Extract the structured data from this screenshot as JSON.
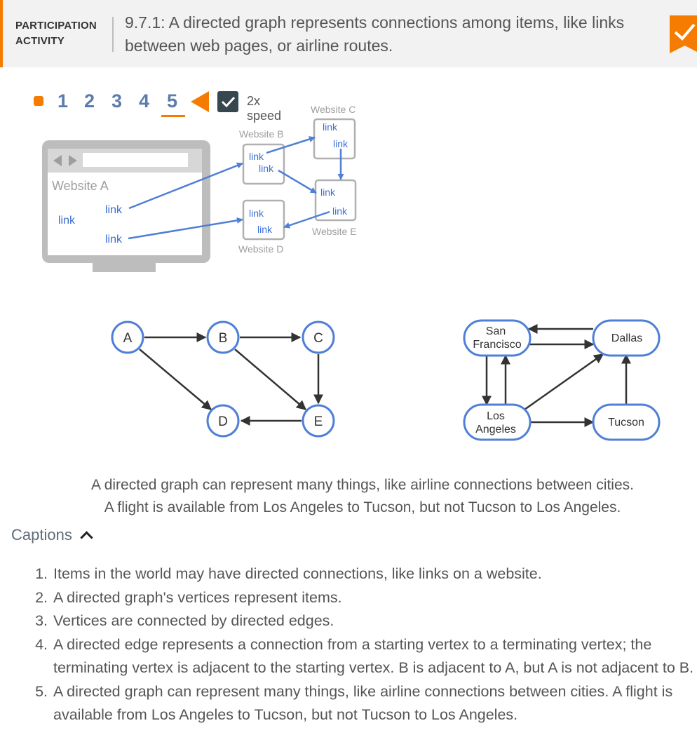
{
  "header": {
    "type_line1": "PARTICIPATION",
    "type_line2": "ACTIVITY",
    "title": "9.7.1: A directed graph represents connections among items, like links between web pages, or airline routes."
  },
  "controls": {
    "steps": [
      "1",
      "2",
      "3",
      "4",
      "5"
    ],
    "active_step": "5",
    "speed_label": "2x speed",
    "speed_checked": true
  },
  "websites": {
    "a_title": "Website A",
    "b_label": "Website B",
    "c_label": "Website C",
    "d_label": "Website D",
    "e_label": "Website E",
    "link": "link"
  },
  "graph1": {
    "a": "A",
    "b": "B",
    "c": "C",
    "d": "D",
    "e": "E"
  },
  "graph2": {
    "sf_line1": "San",
    "sf_line2": "Francisco",
    "dallas": "Dallas",
    "la_line1": "Los",
    "la_line2": "Angeles",
    "tucson": "Tucson"
  },
  "caption": {
    "line1": "A directed graph can represent many things, like airline connections between cities.",
    "line2": "A flight is available from Los Angeles to Tucson, but not Tucson to Los Angeles."
  },
  "captions_toggle": "Captions",
  "captions_list": [
    "Items in the world may have directed connections, like links on a website.",
    "A directed graph's vertices represent items.",
    "Vertices are connected by directed edges.",
    "A directed edge represents a connection from a starting vertex to a terminating vertex; the terminating vertex is adjacent to the starting vertex. B is adjacent to A, but A is not adjacent to B.",
    "A directed graph can represent many things, like airline connections between cities. A flight is available from Los Angeles to Tucson, but not Tucson to Los Angeles."
  ],
  "colors": {
    "accent": "#f57c00",
    "node_stroke": "#4f7fd6",
    "link_text": "#3b6fd4",
    "edge": "#333333"
  }
}
